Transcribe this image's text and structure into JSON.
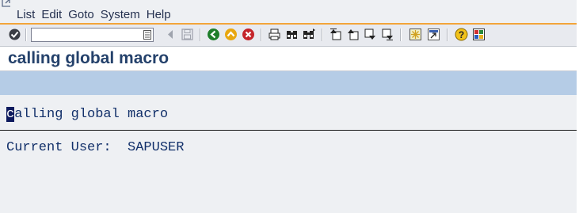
{
  "menubar": {
    "items": [
      "List",
      "Edit",
      "Goto",
      "System",
      "Help"
    ]
  },
  "toolbar": {
    "command_field_value": "",
    "buttons": [
      "enter-icon",
      "back-icon",
      "save-icon",
      "back-green-icon",
      "exit-icon",
      "cancel-icon",
      "print-icon",
      "find-icon",
      "find-next-icon",
      "first-page-icon",
      "previous-page-icon",
      "next-page-icon",
      "last-page-icon",
      "create-session-icon",
      "shortcut-icon",
      "help-icon",
      "customize-layout-icon"
    ]
  },
  "title": {
    "text": "calling global macro"
  },
  "list": {
    "line1_first_char": "c",
    "line1_rest": "alling global macro",
    "line2": "Current User:  SAPUSER"
  },
  "colors": {
    "title": "#24416b",
    "toolbar_accent": "#f3a43a",
    "app_toolbar": "#b5cce6",
    "list_text": "#12306a"
  }
}
